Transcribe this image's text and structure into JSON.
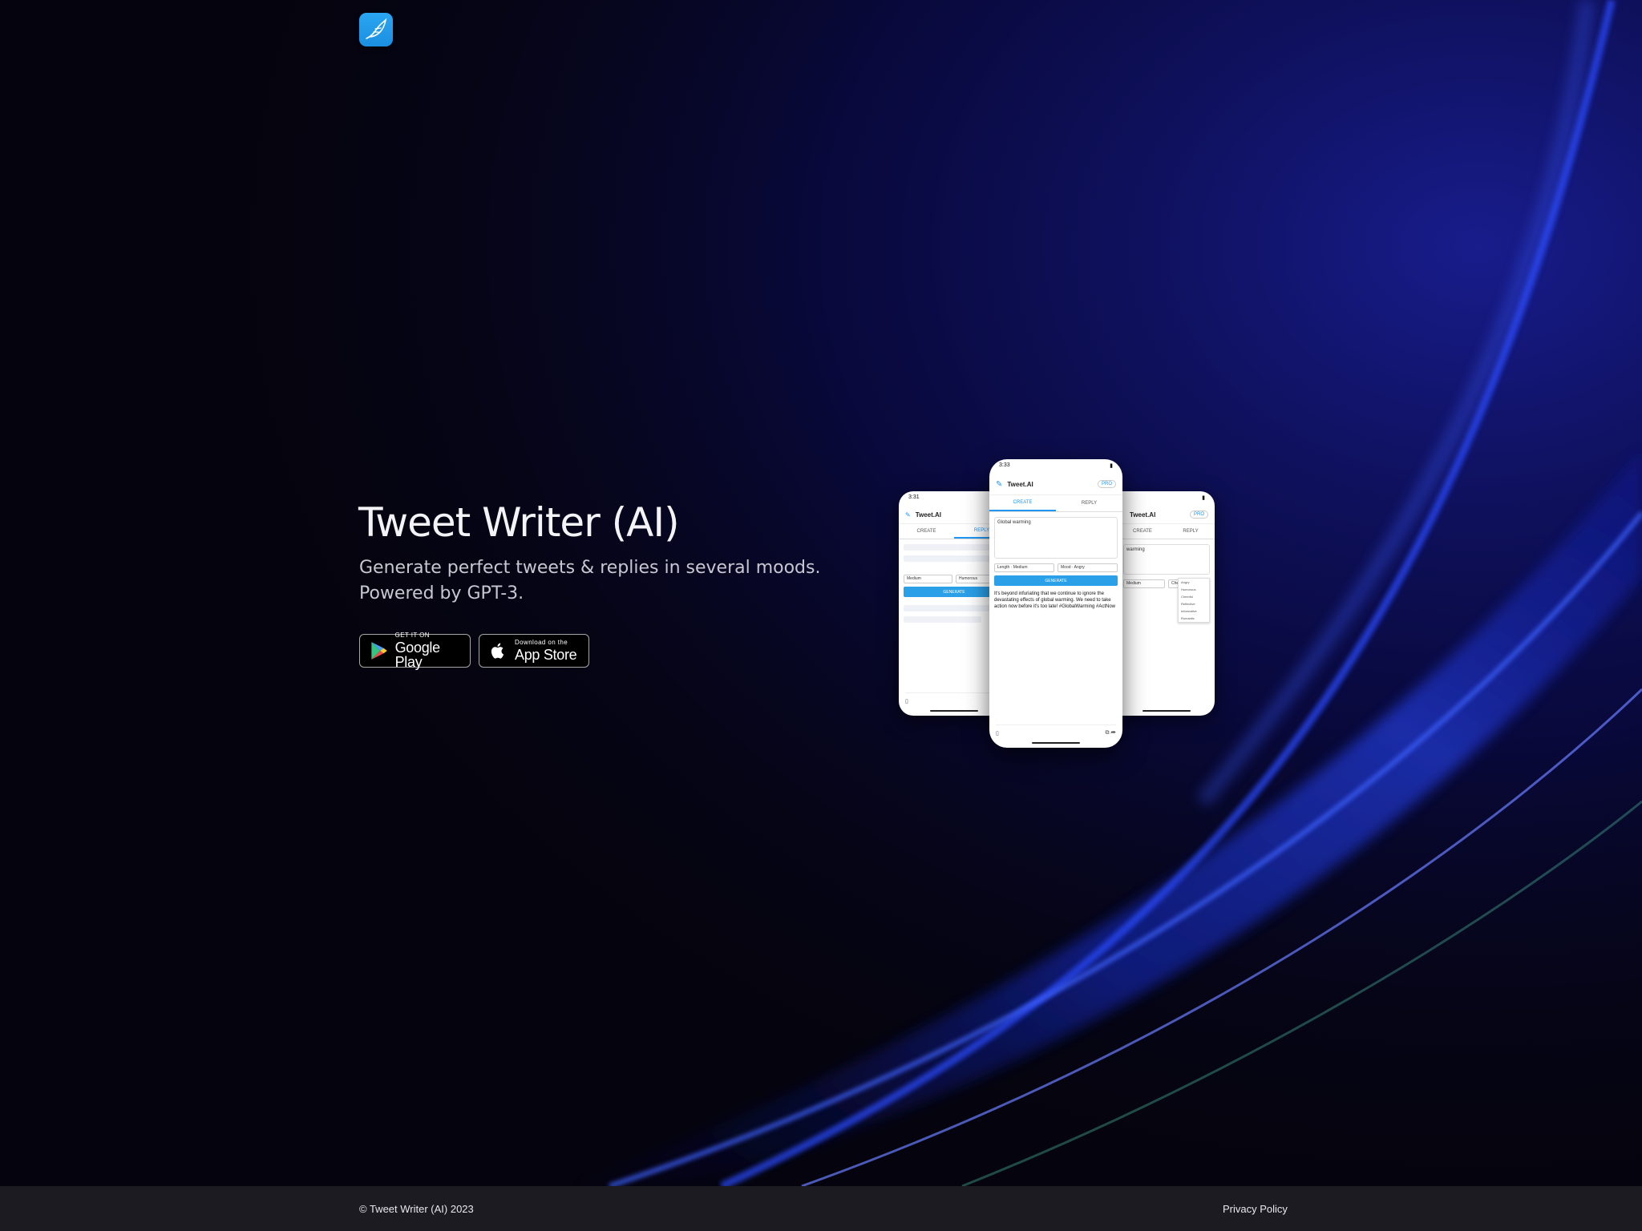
{
  "brand": {
    "logo_icon": "bird-feather-icon",
    "accent": "#2196f3"
  },
  "hero": {
    "title": "Tweet Writer (AI)",
    "subtitle": "Generate perfect tweets & replies in several moods. Powered by GPT-3."
  },
  "stores": {
    "google_small": "GET IT ON",
    "google_big": "Google Play",
    "apple_small": "Download on the",
    "apple_big": "App Store"
  },
  "phone_center": {
    "time": "3:33",
    "app_title": "Tweet.AI",
    "pro": "PRO",
    "tab_create": "CREATE",
    "tab_reply": "REPLY",
    "input": "Global warming",
    "length": "Length · Medium",
    "mood": "Mood · Angry",
    "button": "GENERATE",
    "output": "It's beyond infuriating that we continue to ignore the devastating effects of global warming. We need to take action now before it's too late! #GlobalWarming #ActNow"
  },
  "phone_left": {
    "time": "3:31",
    "app_title": "Tweet.AI",
    "tab_create": "CREATE",
    "tab_reply": "REPLY",
    "length": "Medium",
    "mood": "Humorous",
    "button": "GENERATE"
  },
  "phone_right": {
    "app_title": "Tweet.AI",
    "pro": "PRO",
    "tab_create": "CREATE",
    "tab_reply": "REPLY",
    "input": "warming",
    "length": "Medium",
    "mood": "Cheerful",
    "moods": [
      "Angry",
      "Humorous",
      "Cheerful",
      "Reflective",
      "Informative",
      "Romantic"
    ]
  },
  "footer": {
    "copyright": "© Tweet Writer (AI) 2023",
    "privacy": "Privacy Policy"
  }
}
